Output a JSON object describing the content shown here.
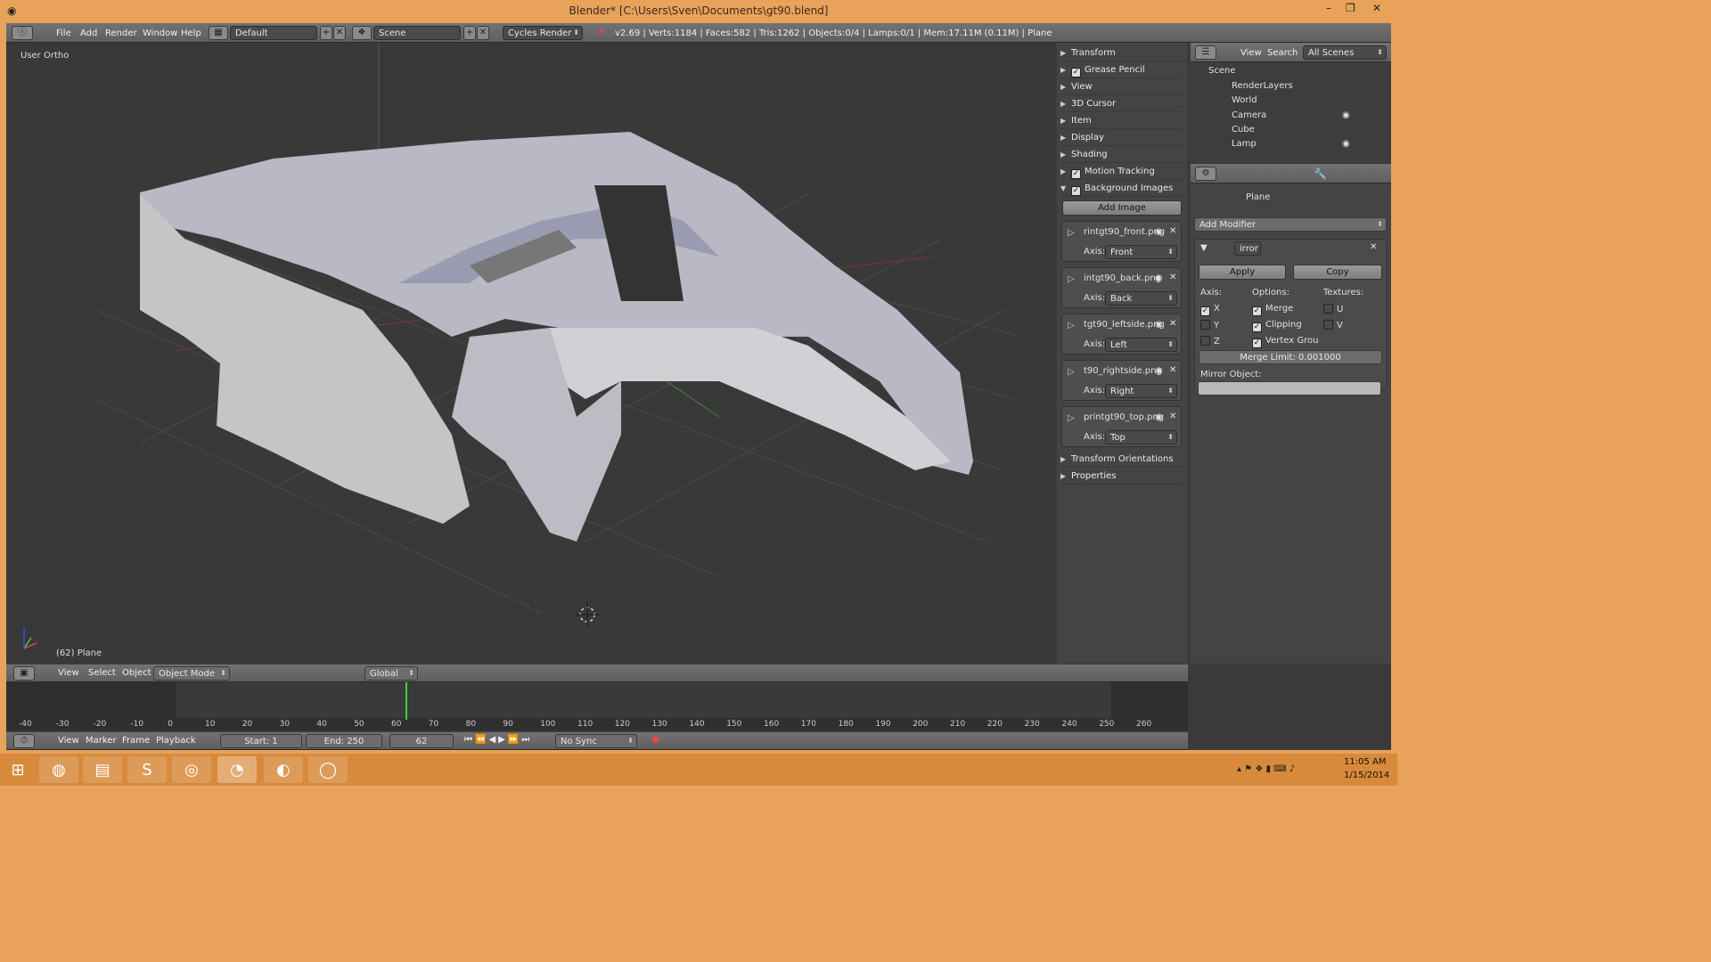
{
  "window": {
    "title": "Blender* [C:\\Users\\Sven\\Documents\\gt90.blend]"
  },
  "topbar": {
    "menus": [
      "File",
      "Add",
      "Render",
      "Window",
      "Help"
    ],
    "layout": "Default",
    "scene": "Scene",
    "engine": "Cycles Render",
    "stats": "v2.69 | Verts:1184 | Faces:582 | Tris:1262 | Objects:0/4 | Lamps:0/1 | Mem:17.11M (0.11M) | Plane"
  },
  "viewport": {
    "view_name": "User Ortho",
    "object_label": "(62) Plane"
  },
  "npanel": {
    "sections": [
      {
        "label": "Transform",
        "check": false
      },
      {
        "label": "Grease Pencil",
        "check": true
      },
      {
        "label": "View",
        "check": false
      },
      {
        "label": "3D Cursor",
        "check": false
      },
      {
        "label": "Item",
        "check": false
      },
      {
        "label": "Display",
        "check": false
      },
      {
        "label": "Shading",
        "check": false
      },
      {
        "label": "Motion Tracking",
        "check": true
      },
      {
        "label": "Background Images",
        "check": true,
        "open": true
      }
    ],
    "add_image": "Add Image",
    "axis_label": "Axis:",
    "images": [
      {
        "name": "rintgt90_front.png",
        "axis": "Front"
      },
      {
        "name": "intgt90_back.png",
        "axis": "Back"
      },
      {
        "name": "tgt90_leftside.png",
        "axis": "Left"
      },
      {
        "name": "t90_rightside.png",
        "axis": "Right"
      },
      {
        "name": "printgt90_top.png",
        "axis": "Top"
      }
    ],
    "footer": [
      "Transform Orientations",
      "Properties"
    ]
  },
  "outliner": {
    "view": "View",
    "search": "Search",
    "filter": "All Scenes",
    "items": [
      {
        "label": "Scene"
      },
      {
        "label": "RenderLayers"
      },
      {
        "label": "World"
      },
      {
        "label": "Camera"
      },
      {
        "label": "Cube"
      },
      {
        "label": "Lamp"
      }
    ]
  },
  "props": {
    "breadcrumb": "Plane",
    "add_modifier": "Add Modifier",
    "modifier_name": "irror",
    "apply": "Apply",
    "copy": "Copy",
    "axis_h": "Axis:",
    "options_h": "Options:",
    "textures_h": "Textures:",
    "axes": [
      {
        "l": "X",
        "on": true
      },
      {
        "l": "Y",
        "on": false
      },
      {
        "l": "Z",
        "on": false
      }
    ],
    "options": [
      {
        "l": "Merge",
        "on": true
      },
      {
        "l": "Clipping",
        "on": true
      },
      {
        "l": "Vertex Grou",
        "on": true
      }
    ],
    "textures": [
      {
        "l": "U",
        "on": false
      },
      {
        "l": "V",
        "on": false
      }
    ],
    "merge_limit": "Merge Limit: 0.001000",
    "mirror_object": "Mirror Object:"
  },
  "view3dhdr": {
    "menus": [
      "View",
      "Select",
      "Object"
    ],
    "mode": "Object Mode",
    "orientation": "Global"
  },
  "timeline": {
    "ticks": [
      "-40",
      "-30",
      "-20",
      "-10",
      "0",
      "10",
      "20",
      "30",
      "40",
      "50",
      "60",
      "70",
      "80",
      "90",
      "100",
      "110",
      "120",
      "130",
      "140",
      "150",
      "160",
      "170",
      "180",
      "190",
      "200",
      "210",
      "220",
      "230",
      "240",
      "250",
      "260"
    ],
    "menus": [
      "View",
      "Marker",
      "Frame",
      "Playback"
    ],
    "start": "Start: 1",
    "end": "End: 250",
    "current": "62",
    "sync": "No Sync"
  },
  "taskbar": {
    "time": "11:05 AM",
    "date": "1/15/2014"
  }
}
